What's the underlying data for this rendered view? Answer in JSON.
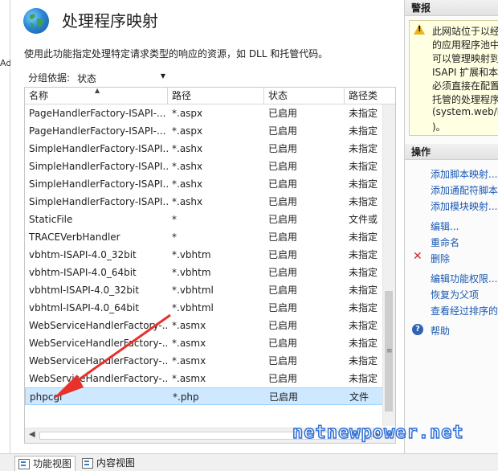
{
  "left_strip_char": "Ad",
  "header": {
    "title": "处理程序映射",
    "description": "使用此功能指定处理特定请求类型的响应的资源，如 DLL 和托管代码。"
  },
  "group_by": {
    "label": "分组依据:",
    "value": "状态"
  },
  "columns": [
    "名称",
    "路径",
    "状态",
    "路径类"
  ],
  "rows": [
    [
      "PageHandlerFactory-ISAPI-...",
      "*.aspx",
      "已启用",
      "未指定"
    ],
    [
      "PageHandlerFactory-ISAPI-...",
      "*.aspx",
      "已启用",
      "未指定"
    ],
    [
      "SimpleHandlerFactory-ISAPI...",
      "*.ashx",
      "已启用",
      "未指定"
    ],
    [
      "SimpleHandlerFactory-ISAPI...",
      "*.ashx",
      "已启用",
      "未指定"
    ],
    [
      "SimpleHandlerFactory-ISAPI...",
      "*.ashx",
      "已启用",
      "未指定"
    ],
    [
      "SimpleHandlerFactory-ISAPI...",
      "*.ashx",
      "已启用",
      "未指定"
    ],
    [
      "StaticFile",
      "*",
      "已启用",
      "文件或"
    ],
    [
      "TRACEVerbHandler",
      "*",
      "已启用",
      "未指定"
    ],
    [
      "vbhtm-ISAPI-4.0_32bit",
      "*.vbhtm",
      "已启用",
      "未指定"
    ],
    [
      "vbhtm-ISAPI-4.0_64bit",
      "*.vbhtm",
      "已启用",
      "未指定"
    ],
    [
      "vbhtml-ISAPI-4.0_32bit",
      "*.vbhtml",
      "已启用",
      "未指定"
    ],
    [
      "vbhtml-ISAPI-4.0_64bit",
      "*.vbhtml",
      "已启用",
      "未指定"
    ],
    [
      "WebServiceHandlerFactory-...",
      "*.asmx",
      "已启用",
      "未指定"
    ],
    [
      "WebServiceHandlerFactory-...",
      "*.asmx",
      "已启用",
      "未指定"
    ],
    [
      "WebServiceHandlerFactory-...",
      "*.asmx",
      "已启用",
      "未指定"
    ],
    [
      "WebServiceHandlerFactory-...",
      "*.asmx",
      "已启用",
      "未指定"
    ],
    [
      "phpcgi",
      "*.php",
      "已启用",
      "文件"
    ]
  ],
  "selected_row": 16,
  "bottom_tabs": {
    "features": "功能视图",
    "content": "内容视图"
  },
  "alerts": {
    "title": "警报",
    "lines": [
      "此网站位于以经",
      "的应用程序池中",
      "可以管理映射到",
      "ISAPI 扩展和本",
      "必须直接在配置",
      "托管的处理程序",
      "(system.web/h",
      ")。"
    ]
  },
  "actions": {
    "title": "操作",
    "add_script_map": "添加脚本映射...",
    "add_wildcard_map": "添加通配符脚本",
    "add_module_map": "添加模块映射...",
    "edit": "编辑...",
    "rename": "重命名",
    "delete": "删除",
    "edit_permissions": "编辑功能权限...",
    "revert": "恢复为父项",
    "view_ordered": "查看经过排序的",
    "help": "帮助"
  },
  "watermark": "netnewpower.net",
  "colors": {
    "link": "#1a59b3",
    "selection": "#cde8ff",
    "alert_bg": "#ffffe1",
    "annotation_arrow": "#e8312a"
  }
}
